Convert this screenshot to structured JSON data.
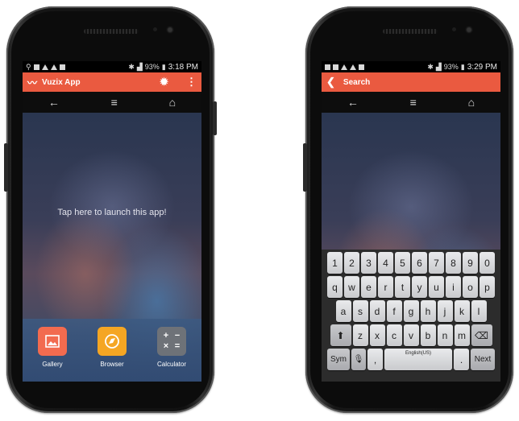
{
  "left_phone": {
    "status_time": "3:18 PM",
    "status_battery": "93%",
    "app_title": "Vuzix App",
    "tap_text": "Tap here to launch this app!",
    "dock": [
      {
        "label": "Gallery",
        "icon": "gallery-icon",
        "color": "#f26b4f"
      },
      {
        "label": "Browser",
        "icon": "browser-icon",
        "color": "#f5a623"
      },
      {
        "label": "Calculator",
        "icon": "calculator-icon",
        "color": "#6e7278"
      }
    ],
    "accent": "#ea5a40"
  },
  "right_phone": {
    "status_time": "3:29 PM",
    "status_battery": "93%",
    "title": "Search",
    "keyboard": {
      "row_numbers": [
        "1",
        "2",
        "3",
        "4",
        "5",
        "6",
        "7",
        "8",
        "9",
        "0"
      ],
      "row_1": [
        "q",
        "w",
        "e",
        "r",
        "t",
        "y",
        "u",
        "i",
        "o",
        "p"
      ],
      "row_2": [
        "a",
        "s",
        "d",
        "f",
        "g",
        "h",
        "j",
        "k",
        "l"
      ],
      "row_3": [
        "z",
        "x",
        "c",
        "v",
        "b",
        "n",
        "m"
      ],
      "sym": "Sym",
      "comma": ",",
      "space_label": "English(US)",
      "period": ".",
      "next": "Next"
    }
  },
  "nav_icons": [
    "back-arrow-icon",
    "menu-lines-icon",
    "home-icon"
  ]
}
